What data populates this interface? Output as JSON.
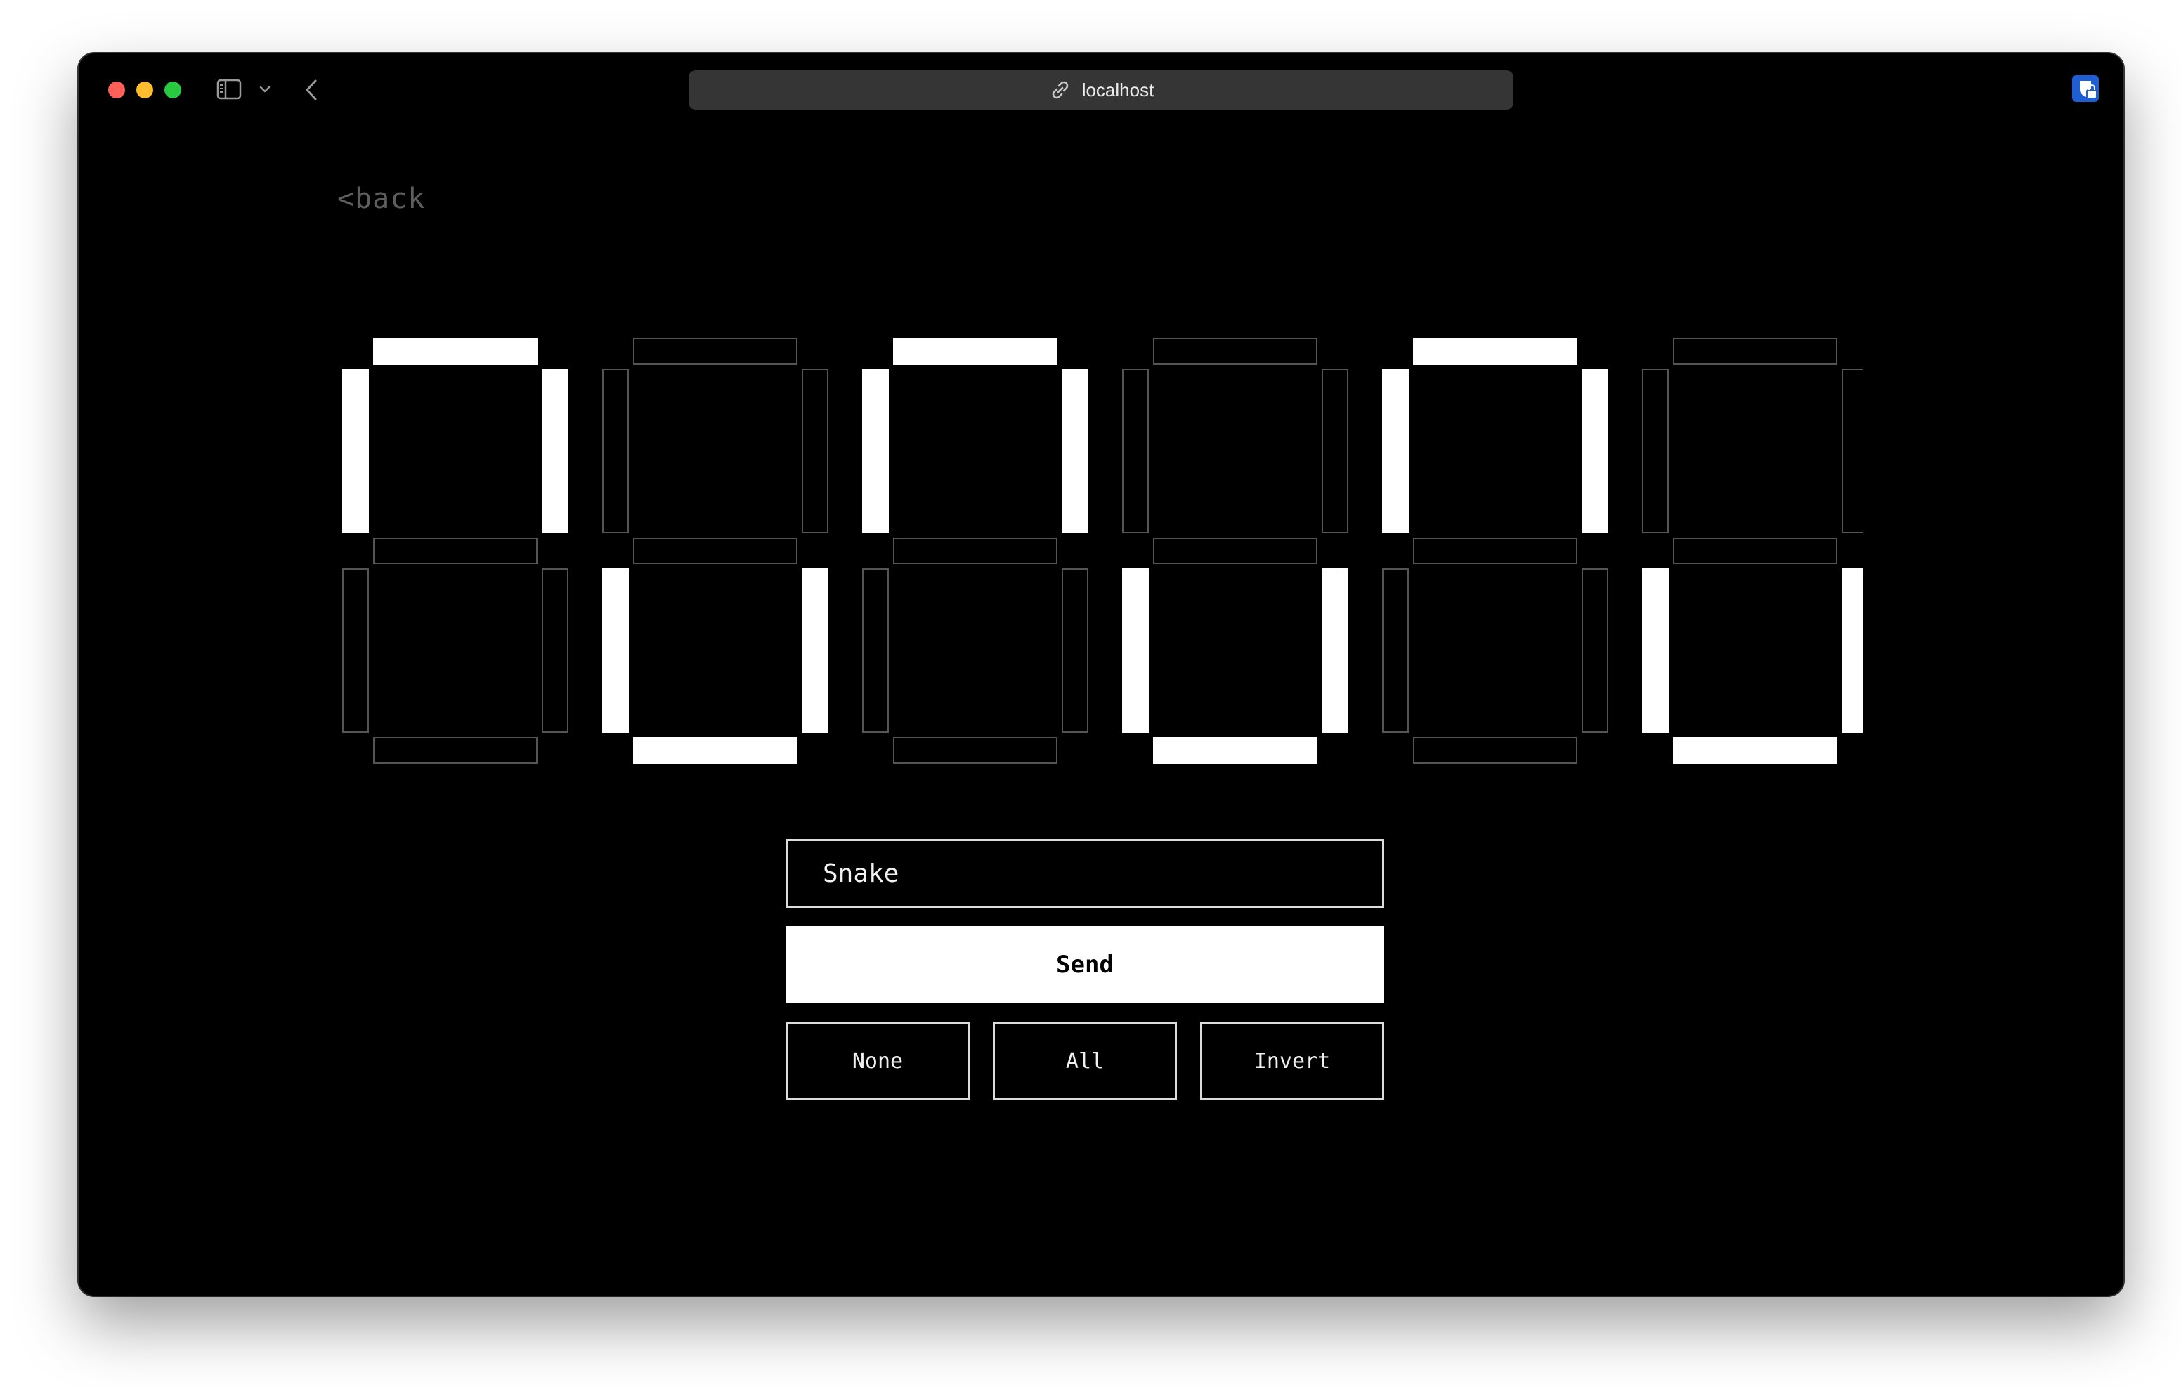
{
  "browser": {
    "url": "localhost"
  },
  "page": {
    "back_label": "<back",
    "input_value": "Snake",
    "send_label": "Send",
    "buttons": [
      "None",
      "All",
      "Invert"
    ]
  },
  "display": {
    "digit_count": 6,
    "lit_segments": [
      [
        "a",
        "b",
        "f"
      ],
      [
        "c",
        "d",
        "e"
      ],
      [
        "a",
        "b",
        "f"
      ],
      [
        "c",
        "d",
        "e"
      ],
      [
        "a",
        "b",
        "f"
      ],
      [
        "c",
        "d",
        "e"
      ]
    ],
    "colors": {
      "lit": "#ffffff",
      "unlit_stroke": "#555555",
      "background": "#000000"
    }
  }
}
